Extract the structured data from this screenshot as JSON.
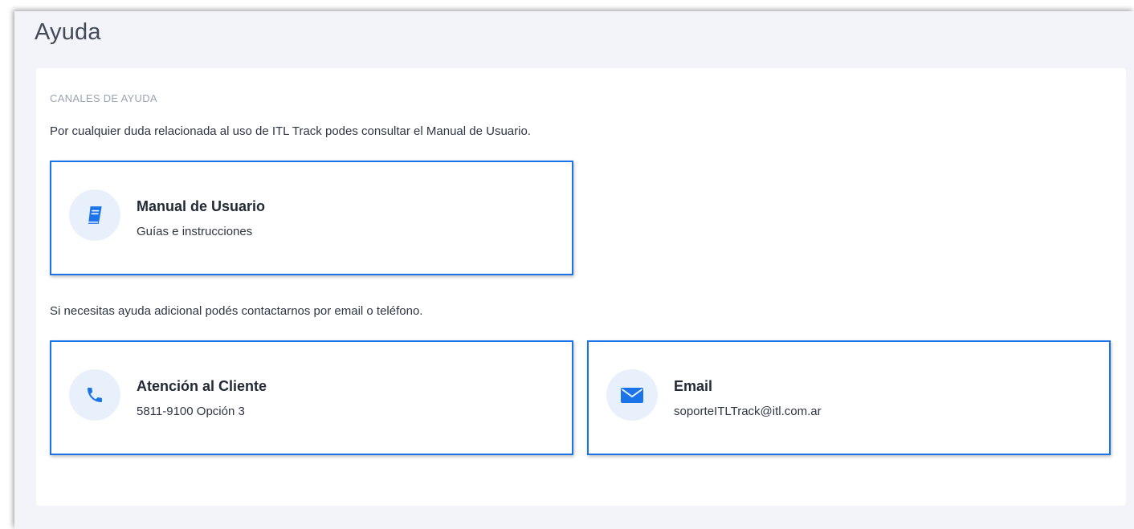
{
  "page": {
    "title": "Ayuda"
  },
  "help": {
    "section_label": "CANALES DE AYUDA",
    "intro": "Por cualquier duda relacionada al uso de ITL Track podes consultar el Manual de Usuario.",
    "extra": "Si necesitas ayuda adicional podés contactarnos por email o teléfono.",
    "manual": {
      "icon": "book-icon",
      "title": "Manual de Usuario",
      "subtitle": "Guías e instrucciones"
    },
    "phone": {
      "icon": "phone-icon",
      "title": "Atención al Cliente",
      "subtitle": "5811-9100 Opción 3"
    },
    "email": {
      "icon": "envelope-icon",
      "title": "Email",
      "subtitle": "soporteITLTrack@itl.com.ar"
    }
  },
  "colors": {
    "accent": "#1a73e8",
    "icon_bg": "#e8f0fb",
    "page_bg": "#f3f4f9"
  }
}
